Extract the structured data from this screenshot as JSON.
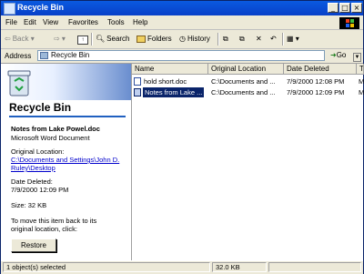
{
  "window": {
    "title": "Recycle Bin"
  },
  "menu": [
    "File",
    "Edit",
    "View",
    "Favorites",
    "Tools",
    "Help"
  ],
  "toolbar": {
    "back": "Back",
    "search": "Search",
    "folders": "Folders",
    "history": "History"
  },
  "address": {
    "label": "Address",
    "value": "Recycle Bin",
    "go": "Go"
  },
  "details": {
    "heading": "Recycle Bin",
    "file_name": "Notes from Lake Powel.doc",
    "file_type": "Microsoft Word Document",
    "original_location_label": "Original Location:",
    "original_location_line1": "C:\\Documents and Settings\\John D.",
    "original_location_line2": "Ruley\\Desktop",
    "date_deleted_label": "Date Deleted:",
    "date_deleted": "7/9/2000 12:09 PM",
    "size": "Size: 32 KB",
    "restore_hint_line1": "To move this item back to its",
    "restore_hint_line2": "original location, click:",
    "restore_button": "Restore"
  },
  "list": {
    "columns": [
      "Name",
      "Original Location",
      "Date Deleted",
      "T"
    ],
    "rows": [
      {
        "name": "hold short.doc",
        "location": "C:\\Documents and ...",
        "date": "7/9/2000 12:08 PM",
        "type": "M",
        "selected": false
      },
      {
        "name": "Notes from Lake ...",
        "location": "C:\\Documents and ...",
        "date": "7/9/2000 12:09 PM",
        "type": "M",
        "selected": true
      }
    ]
  },
  "status": {
    "selection": "1 object(s) selected",
    "size": "32.0 KB"
  }
}
